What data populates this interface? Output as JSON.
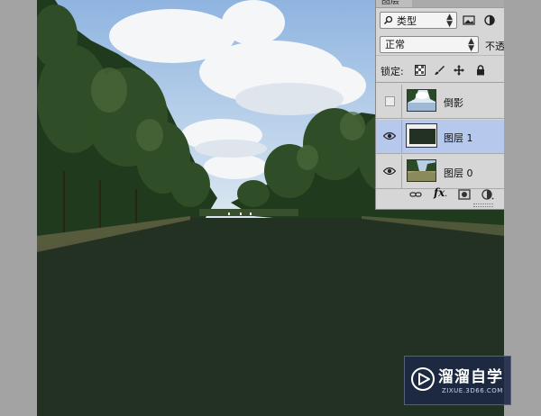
{
  "layers_panel": {
    "tab_label": "图层",
    "filter": {
      "label": "类型",
      "icon": "search-icon"
    },
    "blend_mode": "正常",
    "opacity_label": "不透",
    "lock_label": "锁定:",
    "layers": [
      {
        "name": "倒影",
        "visible": false,
        "selected": false
      },
      {
        "name": "图层 1",
        "visible": true,
        "selected": true
      },
      {
        "name": "图层 0",
        "visible": true,
        "selected": false
      }
    ],
    "footer_icons": [
      "link-icon",
      "fx-icon",
      "mask-icon",
      "adjustment-icon"
    ]
  },
  "watermark": {
    "title": "溜溜自学",
    "subtitle": "ZIXUE.3D66.COM"
  },
  "colors": {
    "ground": "#233123",
    "selected_layer": "#b6c8ec",
    "panel_bg": "#d6d6d6"
  }
}
